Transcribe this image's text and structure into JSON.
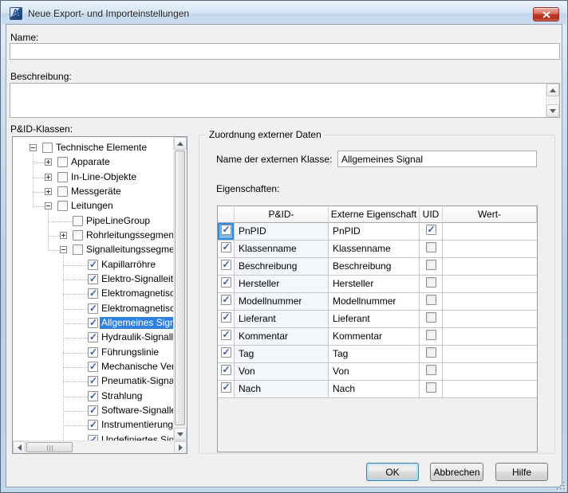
{
  "window": {
    "title": "Neue Export- und Importeinstellungen"
  },
  "form": {
    "name_label": "Name:",
    "name_value": "",
    "description_label": "Beschreibung:",
    "description_value": ""
  },
  "tree": {
    "label": "P&ID-Klassen:",
    "items": [
      {
        "label": "Technische Elemente",
        "level": 0,
        "expander": "minus",
        "checked": false,
        "selected": false
      },
      {
        "label": "Apparate",
        "level": 1,
        "expander": "plus",
        "checked": false,
        "selected": false
      },
      {
        "label": "In-Line-Objekte",
        "level": 1,
        "expander": "plus",
        "checked": false,
        "selected": false
      },
      {
        "label": "Messgeräte",
        "level": 1,
        "expander": "plus",
        "checked": false,
        "selected": false
      },
      {
        "label": "Leitungen",
        "level": 1,
        "expander": "minus",
        "checked": false,
        "selected": false
      },
      {
        "label": "PipeLineGroup",
        "level": 2,
        "expander": "none",
        "checked": false,
        "selected": false
      },
      {
        "label": "Rohrleitungssegmente",
        "level": 2,
        "expander": "plus",
        "checked": false,
        "selected": false
      },
      {
        "label": "Signalleitungssegmente",
        "level": 2,
        "expander": "minus",
        "checked": false,
        "selected": false
      },
      {
        "label": "Kapillarröhre",
        "level": 3,
        "expander": "none",
        "checked": true,
        "selected": false
      },
      {
        "label": "Elektro-Signalleitung",
        "level": 3,
        "expander": "none",
        "checked": true,
        "selected": false
      },
      {
        "label": "Elektromagnetisches S",
        "level": 3,
        "expander": "none",
        "checked": true,
        "selected": false
      },
      {
        "label": "Elektromagnetisches S",
        "level": 3,
        "expander": "none",
        "checked": true,
        "selected": false
      },
      {
        "label": "Allgemeines Signal",
        "level": 3,
        "expander": "none",
        "checked": true,
        "selected": true
      },
      {
        "label": "Hydraulik-Signalleitung",
        "level": 3,
        "expander": "none",
        "checked": true,
        "selected": false
      },
      {
        "label": "Führungslinie",
        "level": 3,
        "expander": "none",
        "checked": true,
        "selected": false
      },
      {
        "label": "Mechanische Verbindu",
        "level": 3,
        "expander": "none",
        "checked": true,
        "selected": false
      },
      {
        "label": "Pneumatik-Signalleitun",
        "level": 3,
        "expander": "none",
        "checked": true,
        "selected": false
      },
      {
        "label": "Strahlung",
        "level": 3,
        "expander": "none",
        "checked": true,
        "selected": false
      },
      {
        "label": "Software-Signalleitung",
        "level": 3,
        "expander": "none",
        "checked": true,
        "selected": false
      },
      {
        "label": "Instrumentierungs-Zub",
        "level": 3,
        "expander": "none",
        "checked": true,
        "selected": false
      },
      {
        "label": "Undefiniertes Signal",
        "level": 3,
        "expander": "none",
        "checked": true,
        "selected": false
      }
    ]
  },
  "mapping": {
    "group_title": "Zuordnung externer Daten",
    "external_class_label": "Name der externen Klasse:",
    "external_class_value": "Allgemeines Signal",
    "properties_label": "Eigenschaften:",
    "table": {
      "columns": [
        "",
        "P&ID-",
        "Externe Eigenschaft",
        "UID",
        "Wert-"
      ],
      "rows": [
        {
          "enabled": true,
          "pid": "PnPID",
          "external": "PnPID",
          "uid": true,
          "wert": "",
          "selected": true
        },
        {
          "enabled": true,
          "pid": "Klassenname",
          "external": "Klassenname",
          "uid": false,
          "wert": "",
          "selected": false
        },
        {
          "enabled": true,
          "pid": "Beschreibung",
          "external": "Beschreibung",
          "uid": false,
          "wert": "",
          "selected": false
        },
        {
          "enabled": true,
          "pid": "Hersteller",
          "external": "Hersteller",
          "uid": false,
          "wert": "",
          "selected": false
        },
        {
          "enabled": true,
          "pid": "Modellnummer",
          "external": "Modellnummer",
          "uid": false,
          "wert": "",
          "selected": false
        },
        {
          "enabled": true,
          "pid": "Lieferant",
          "external": "Lieferant",
          "uid": false,
          "wert": "",
          "selected": false
        },
        {
          "enabled": true,
          "pid": "Kommentar",
          "external": "Kommentar",
          "uid": false,
          "wert": "",
          "selected": false
        },
        {
          "enabled": true,
          "pid": "Tag",
          "external": "Tag",
          "uid": false,
          "wert": "",
          "selected": false
        },
        {
          "enabled": true,
          "pid": "Von",
          "external": "Von",
          "uid": false,
          "wert": "",
          "selected": false
        },
        {
          "enabled": true,
          "pid": "Nach",
          "external": "Nach",
          "uid": false,
          "wert": "",
          "selected": false
        }
      ]
    }
  },
  "buttons": {
    "ok": "OK",
    "cancel": "Abbrechen",
    "help": "Hilfe"
  },
  "colors": {
    "accent_blue": "#2f80e0",
    "close_red": "#b52f20",
    "dialog_bg": "#f0f0f0"
  }
}
